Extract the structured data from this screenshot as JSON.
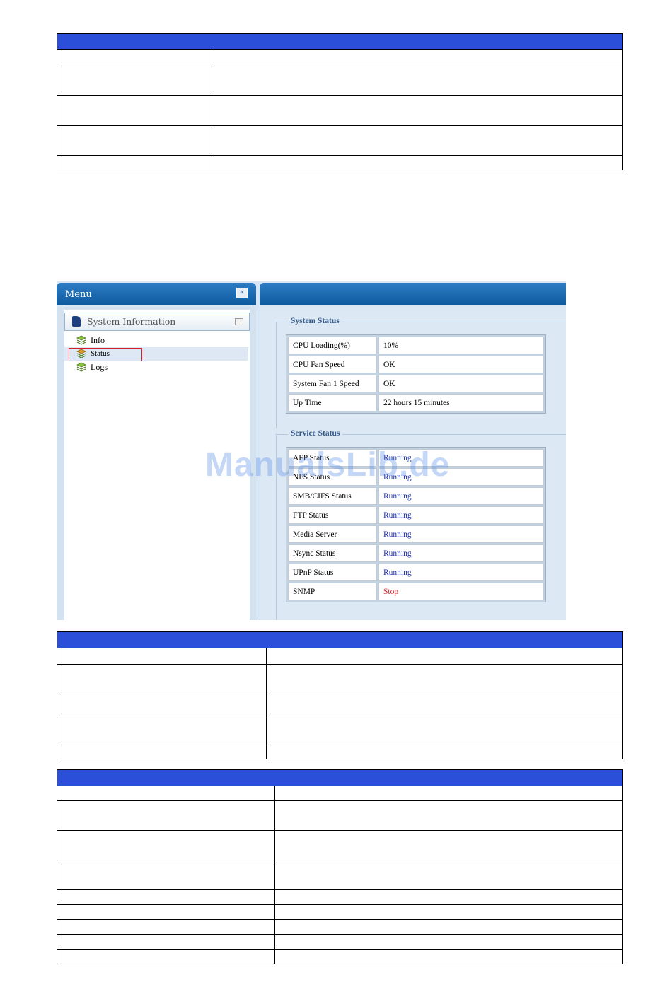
{
  "menu": {
    "title": "Menu",
    "collapse_symbol": "«",
    "section": "System Information",
    "section_toggle": "–",
    "items": [
      {
        "label": "Info"
      },
      {
        "label": "Status",
        "selected": true
      },
      {
        "label": "Logs"
      }
    ]
  },
  "system_status": {
    "legend": "System Status",
    "rows": [
      {
        "label": "CPU Loading(%)",
        "value": "10%"
      },
      {
        "label": "CPU Fan Speed",
        "value": "OK"
      },
      {
        "label": "System Fan 1 Speed",
        "value": "OK"
      },
      {
        "label": "Up Time",
        "value": "22 hours 15 minutes"
      }
    ]
  },
  "service_status": {
    "legend": "Service Status",
    "rows": [
      {
        "label": "AFP Status",
        "value": "Running"
      },
      {
        "label": "NFS Status",
        "value": "Running"
      },
      {
        "label": "SMB/CIFS Status",
        "value": "Running"
      },
      {
        "label": "FTP Status",
        "value": "Running"
      },
      {
        "label": "Media Server",
        "value": "Running"
      },
      {
        "label": "Nsync Status",
        "value": "Running"
      },
      {
        "label": "UPnP Status",
        "value": "Running"
      },
      {
        "label": "SNMP",
        "value": "Stop"
      }
    ]
  },
  "watermark": "ManualsLib.de",
  "colors": {
    "table_header": "#2b4fd8",
    "running": "#1d2fb8",
    "stop": "#d62020",
    "panel_header": "#1565ad"
  }
}
